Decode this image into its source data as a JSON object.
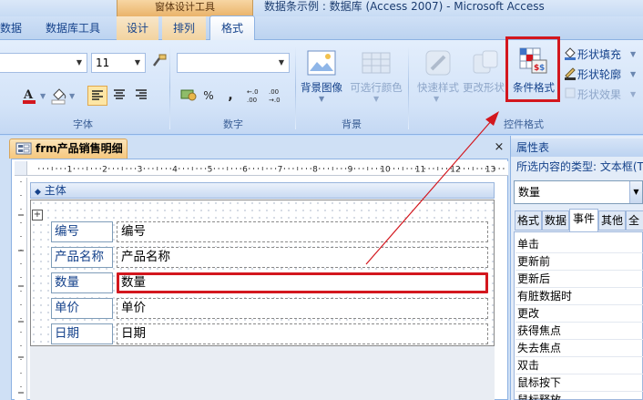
{
  "window": {
    "contextual_tab_title": "窗体设计工具",
    "title": "数据条示例 : 数据库 (Access 2007)  -  Microsoft Access"
  },
  "tabs": [
    {
      "label": "数据"
    },
    {
      "label": "数据库工具"
    },
    {
      "label": "设计"
    },
    {
      "label": "排列"
    },
    {
      "label": "格式"
    }
  ],
  "ribbon": {
    "font_size_value": "11",
    "font_group_label": "字体",
    "number_group_label": "数字",
    "number_percent": "%",
    "number_comma": ",",
    "number_inc_decimal": "+.0 .00",
    "number_dec_decimal": ".00 →.0",
    "background_image_label": "背景图像",
    "alternate_color_label": "可选行颜色",
    "background_group_label": "背景",
    "quick_styles_label": "快速样式",
    "change_shape_label": "更改形状",
    "conditional_format_label": "条件格式",
    "shape_fill_label": "形状填充",
    "shape_outline_label": "形状轮廓",
    "shape_effects_label": "形状效果",
    "control_format_group_label": "控件格式"
  },
  "document": {
    "tab_title": "frm产品销售明细",
    "close_glyph": "×",
    "ruler_numbers": [
      "1",
      "2",
      "3",
      "4",
      "5",
      "6",
      "7",
      "8",
      "9",
      "10",
      "11",
      "12",
      "13"
    ],
    "section_title": "主体",
    "fields": [
      {
        "label": "编号",
        "value": "编号"
      },
      {
        "label": "产品名称",
        "value": "产品名称"
      },
      {
        "label": "数量",
        "value": "数量"
      },
      {
        "label": "单价",
        "value": "单价"
      },
      {
        "label": "日期",
        "value": "日期"
      }
    ]
  },
  "property_sheet": {
    "title": "属性表",
    "selection_type": "所选内容的类型: 文本框(T",
    "selected_object": "数量",
    "tabs": [
      "格式",
      "数据",
      "事件",
      "其他",
      "全部"
    ],
    "active_tab": "事件",
    "events": [
      "单击",
      "更新前",
      "更新后",
      "有脏数据时",
      "更改",
      "获得焦点",
      "失去焦点",
      "双击",
      "鼠标按下",
      "鼠标释放"
    ]
  },
  "colors": {
    "highlight": "#d3171e",
    "ribbon_text": "#15428b",
    "contextual_tab": "#eab36a"
  }
}
